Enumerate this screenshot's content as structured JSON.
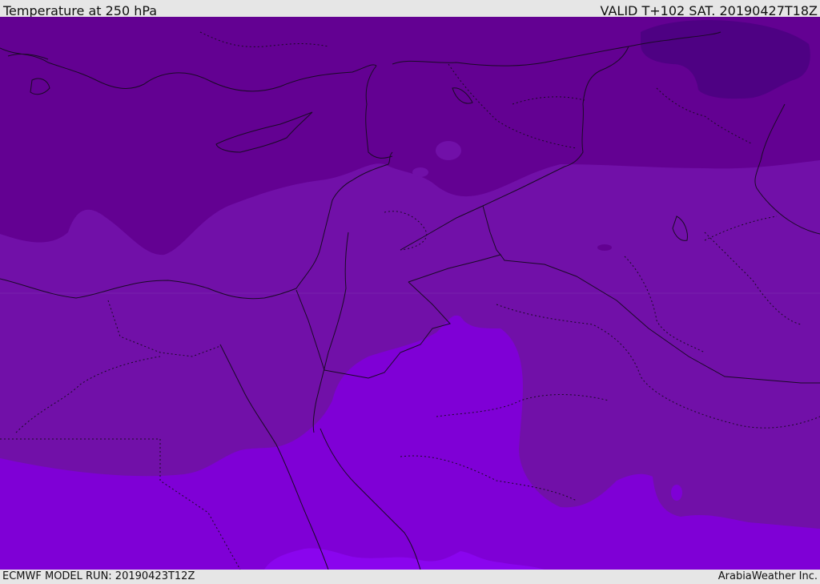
{
  "header": {
    "title": "Temperature at 250 hPa",
    "valid": "VALID T+102 SAT. 20190427T18Z"
  },
  "footer": {
    "model_run": "ECMWF MODEL RUN: 20190423T12Z",
    "credit": "ArabiaWeather Inc."
  },
  "map": {
    "field": "temperature_250hPa",
    "colors": {
      "coldest": "#4e0183",
      "cold": "#630192",
      "mid": "#7110a8",
      "warm": "#7f00d6",
      "warmest": "#8a05ee",
      "coastline": "#1a0a26"
    }
  }
}
